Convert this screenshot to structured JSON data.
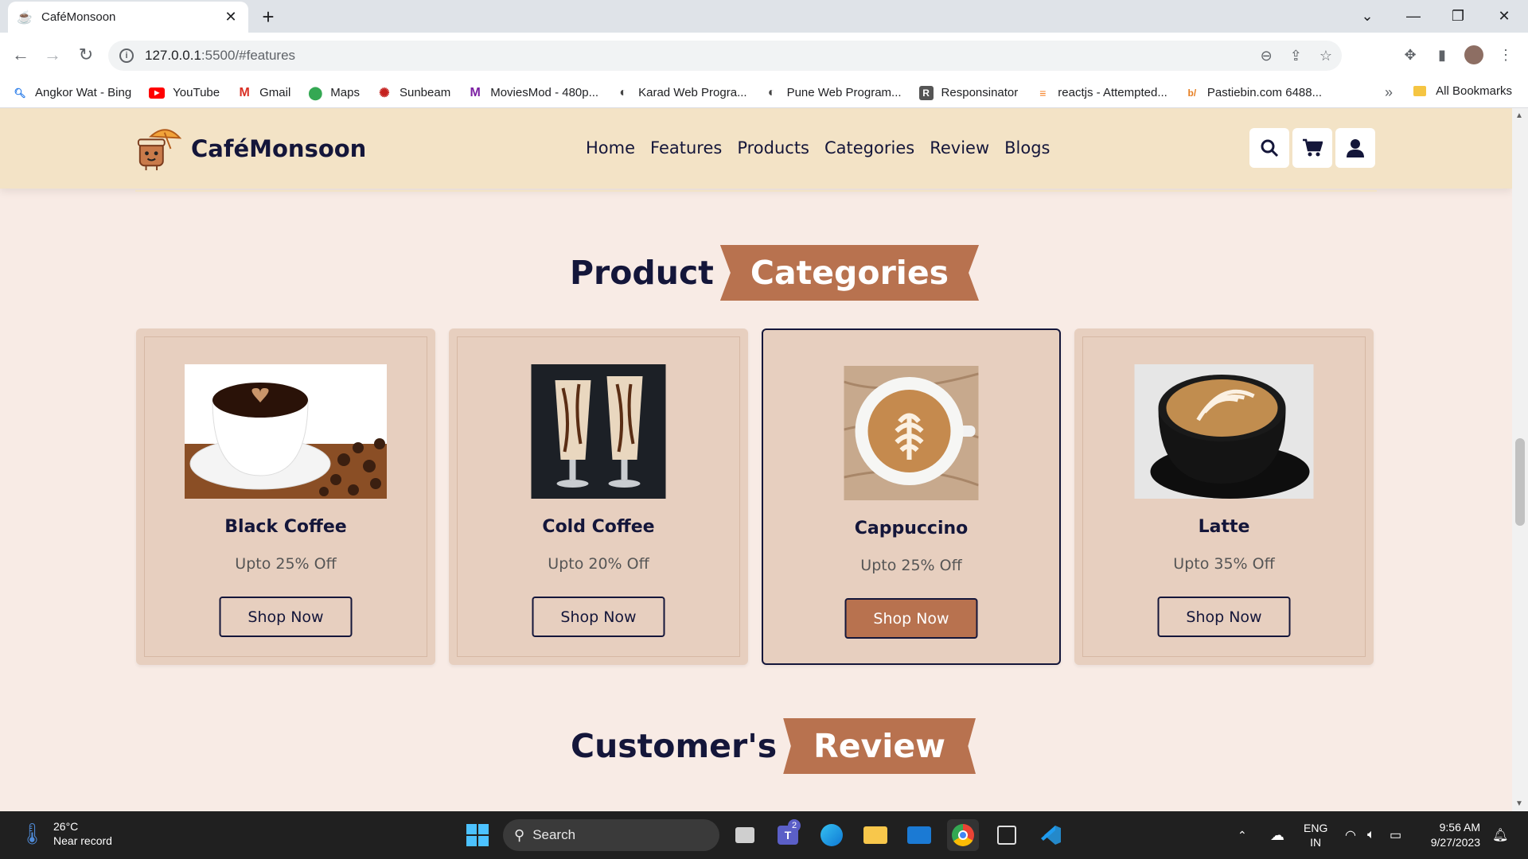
{
  "browser": {
    "tab_title": "CaféMonsoon",
    "url_host": "127.0.0.1",
    "url_rest": ":5500/#features",
    "bookmarks": [
      {
        "label": "Angkor Wat - Bing",
        "icon": "bing-search-icon",
        "color": "#1a73e8"
      },
      {
        "label": "YouTube",
        "icon": "youtube-icon",
        "color": "#ff0000"
      },
      {
        "label": "Gmail",
        "icon": "gmail-icon",
        "color": "#d93025"
      },
      {
        "label": "Maps",
        "icon": "maps-pin-icon",
        "color": "#34a853"
      },
      {
        "label": "Sunbeam",
        "icon": "sunbeam-icon",
        "color": "#c5221f"
      },
      {
        "label": "MoviesMod - 480p...",
        "icon": "moviesmod-icon",
        "color": "#7b1fa2"
      },
      {
        "label": "Karad Web Progra...",
        "icon": "globe-icon",
        "color": "#444"
      },
      {
        "label": "Pune Web Program...",
        "icon": "globe-icon",
        "color": "#444"
      },
      {
        "label": "Responsinator",
        "icon": "responsinator-icon",
        "color": "#555"
      },
      {
        "label": "reactjs - Attempted...",
        "icon": "stackoverflow-icon",
        "color": "#f48024"
      },
      {
        "label": "Pastiebin.com 6488...",
        "icon": "pastebin-icon",
        "color": "#e67e22"
      }
    ],
    "all_bookmarks": "All Bookmarks",
    "more": "»"
  },
  "site": {
    "brand": "CaféMonsoon",
    "nav": [
      "Home",
      "Features",
      "Products",
      "Categories",
      "Review",
      "Blogs"
    ],
    "section1": {
      "plain": "Product",
      "ribbon": "Categories"
    },
    "section2": {
      "plain": "Customer's",
      "ribbon": "Review"
    },
    "categories": [
      {
        "name": "Black Coffee",
        "offer": "Upto 25% Off",
        "button": "Shop Now",
        "image": "black-coffee-image"
      },
      {
        "name": "Cold Coffee",
        "offer": "Upto 20% Off",
        "button": "Shop Now",
        "image": "cold-coffee-image"
      },
      {
        "name": "Cappuccino",
        "offer": "Upto 25% Off",
        "button": "Shop Now",
        "image": "cappuccino-image"
      },
      {
        "name": "Latte",
        "offer": "Upto 35% Off",
        "button": "Shop Now",
        "image": "latte-image"
      }
    ],
    "colors": {
      "accent": "#b8724f",
      "navy": "#14163a",
      "header_bg": "#f3e3c6",
      "card_bg": "#e7cfbf",
      "page_bg": "#f8ebe5"
    }
  },
  "taskbar": {
    "temp": "26°C",
    "weather_note": "Near record",
    "search": "Search",
    "teams_badge": "2",
    "lang1": "ENG",
    "lang2": "IN",
    "time": "9:56 AM",
    "date": "9/27/2023"
  }
}
